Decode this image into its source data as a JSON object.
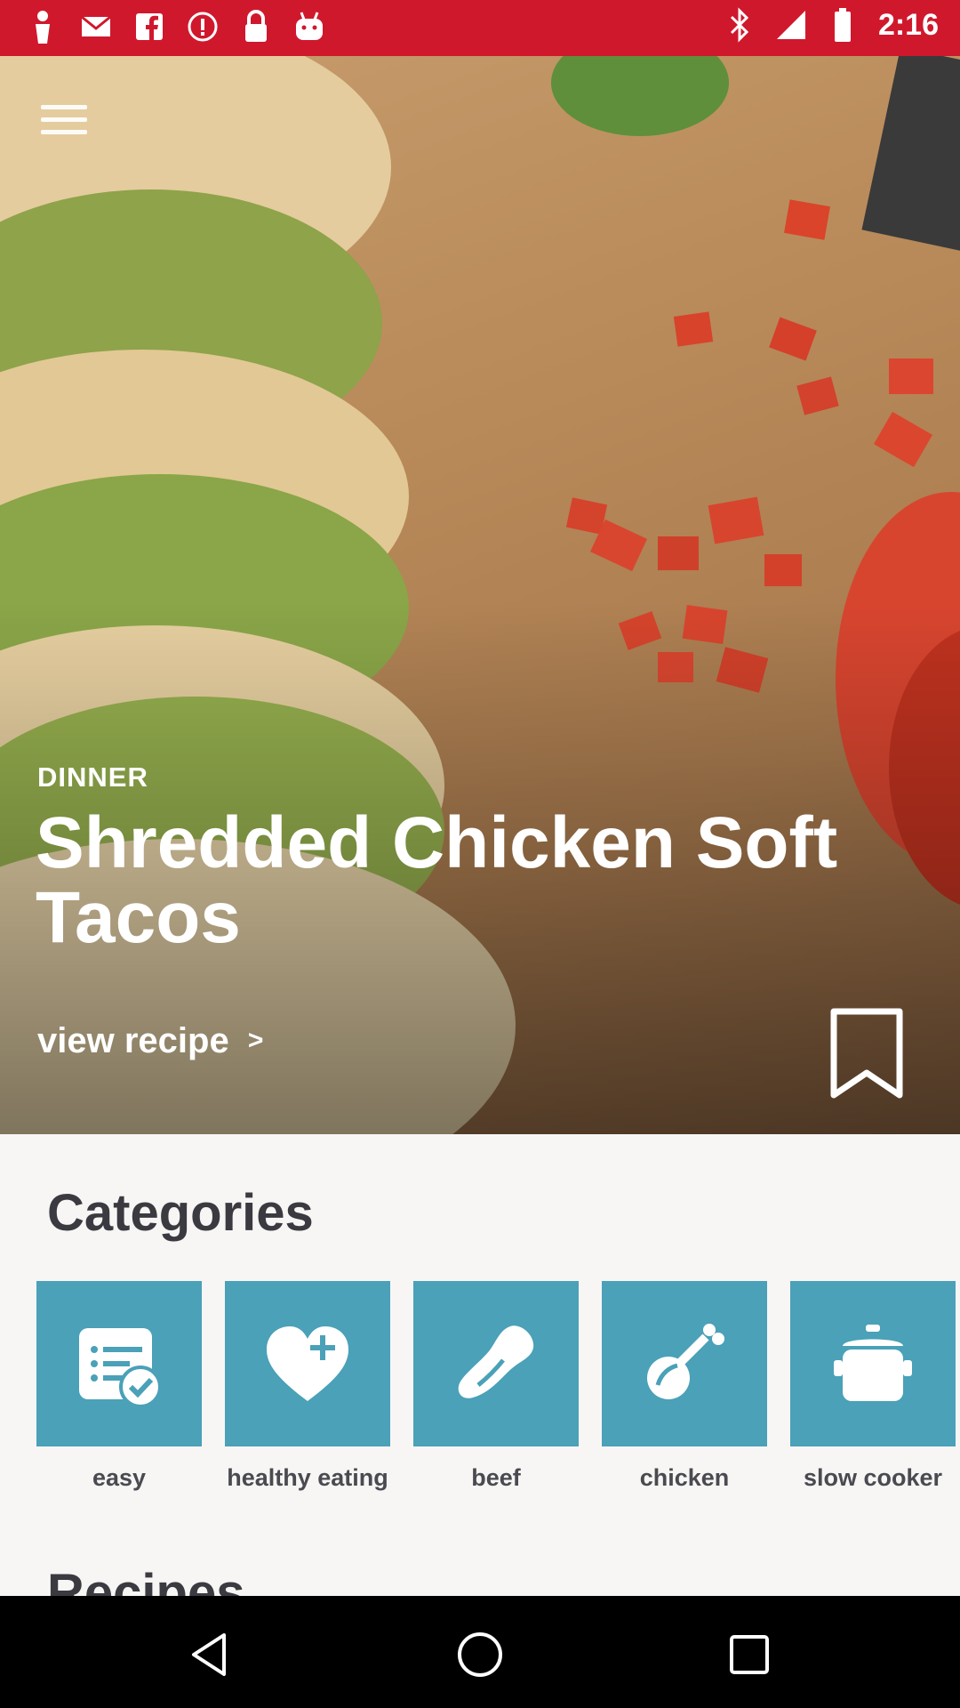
{
  "status_bar": {
    "time": "2:16",
    "left_icons": [
      "person-icon",
      "mail-icon",
      "facebook-icon",
      "info-icon",
      "lock-icon",
      "robot-icon"
    ],
    "right_icons": [
      "bluetooth-icon",
      "signal-icon",
      "battery-icon"
    ],
    "color": "#d0182d"
  },
  "hero": {
    "category": "DINNER",
    "title": "Shredded Chicken Soft Tacos",
    "link_label": "view recipe",
    "link_arrow": ">"
  },
  "categories": {
    "heading": "Categories",
    "tile_color": "#4aa1b8",
    "items": [
      {
        "label": "easy",
        "icon": "checklist-icon"
      },
      {
        "label": "healthy eating",
        "icon": "heart-plus-icon"
      },
      {
        "label": "beef",
        "icon": "beef-cut-icon"
      },
      {
        "label": "chicken",
        "icon": "drumstick-icon"
      },
      {
        "label": "slow cooker",
        "icon": "pot-icon"
      }
    ]
  },
  "recipes": {
    "heading": "Recipes"
  },
  "nav_bar": {
    "buttons": [
      "back-icon",
      "home-icon",
      "recents-icon"
    ]
  }
}
